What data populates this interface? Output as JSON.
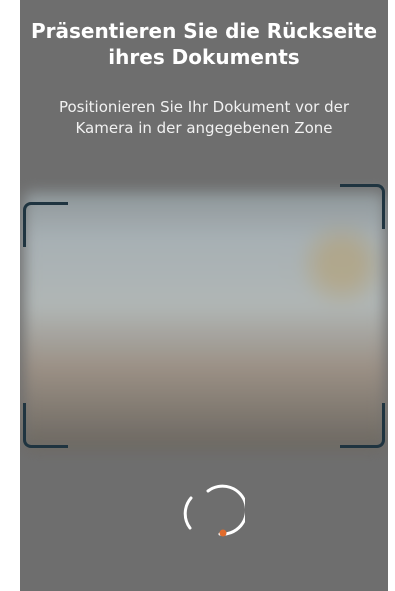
{
  "header": {
    "title": "Präsentieren Sie die Rückseite\nihres Dokuments",
    "instruction": "Positionieren Sie Ihr Dokument vor der\nKamera in der angegebenen Zone"
  },
  "camera": {
    "preview_icon": "document-back-preview",
    "frame_icon": "capture-zone-frame"
  },
  "status": {
    "loader_icon": "loading-spinner-icon"
  },
  "colors": {
    "background": "#6e6e6e",
    "text": "#ffffff",
    "frame": "#1f3440",
    "spinner": "#ffffff",
    "accent": "#e06b2c"
  }
}
